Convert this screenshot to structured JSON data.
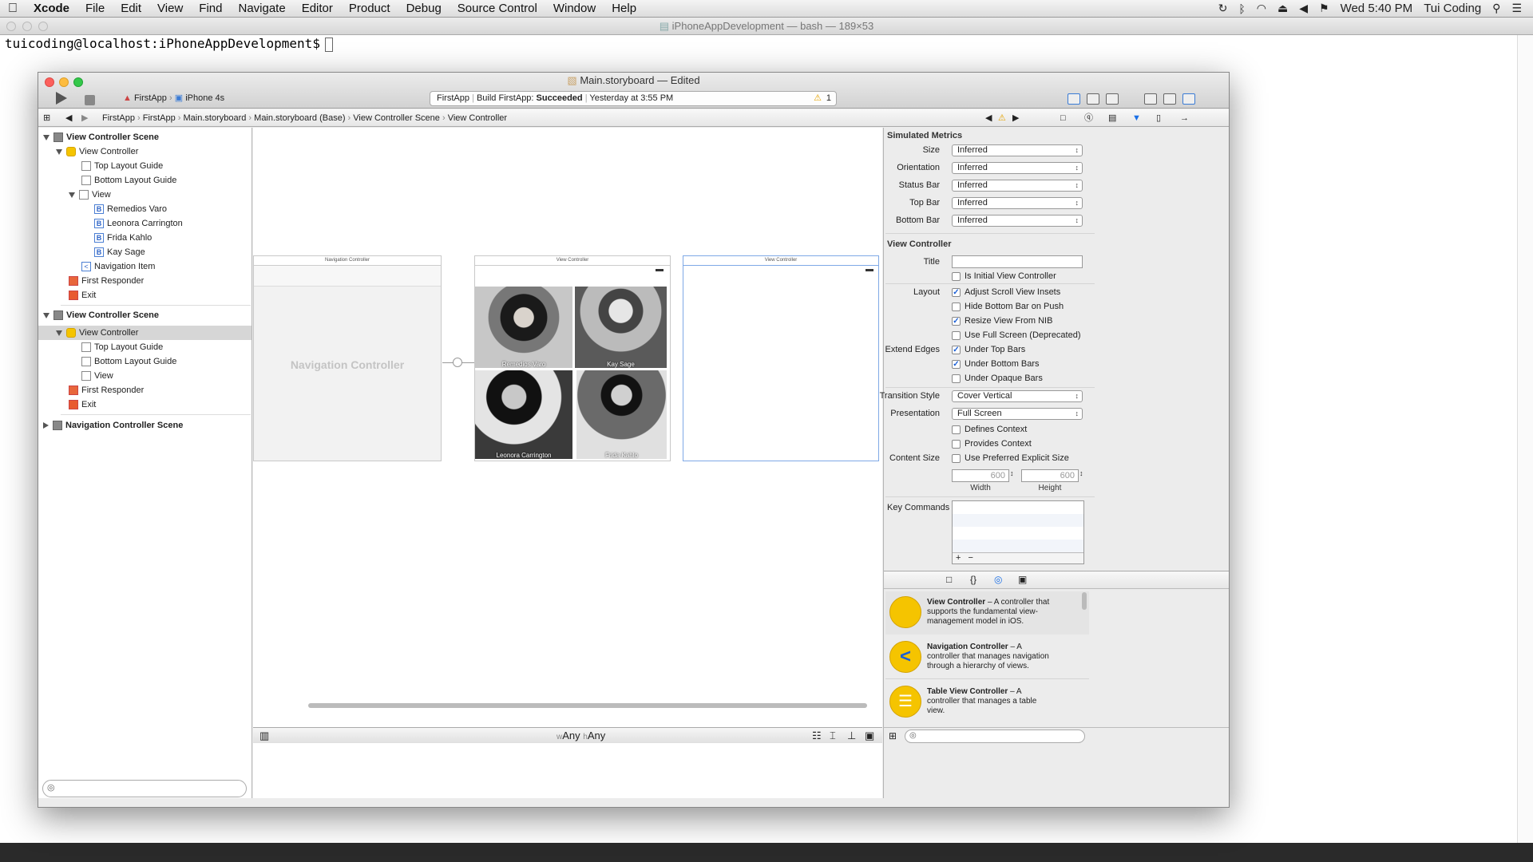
{
  "menubar": {
    "apple": "",
    "app": "Xcode",
    "items": [
      "File",
      "Edit",
      "View",
      "Find",
      "Navigate",
      "Editor",
      "Product",
      "Debug",
      "Source Control",
      "Window",
      "Help"
    ],
    "clock": "Wed 5:40 PM",
    "user": "Tui Coding"
  },
  "terminal": {
    "title": "iPhoneAppDevelopment — bash — 189×53",
    "prompt": "tuicoding@localhost:iPhoneAppDevelopment$"
  },
  "xcode": {
    "title": "Main.storyboard — Edited",
    "scheme_app": "FirstApp",
    "scheme_device": "iPhone 4s",
    "status_app": "FirstApp",
    "status_build": "Build FirstApp:",
    "status_result": "Succeeded",
    "status_time": "Yesterday at 3:55 PM",
    "warnings": "1",
    "jumpbar": [
      "FirstApp",
      "FirstApp",
      "Main.storyboard",
      "Main.storyboard (Base)",
      "View Controller Scene",
      "View Controller"
    ]
  },
  "outline": {
    "scene1": "View Controller Scene",
    "vc1": "View Controller",
    "top1": "Top Layout Guide",
    "bottom1": "Bottom Layout Guide",
    "view1": "View",
    "btn1": "Remedios Varo",
    "btn2": "Leonora Carrington",
    "btn3": "Frida Kahlo",
    "btn4": "Kay Sage",
    "navitem": "Navigation Item",
    "fr1": "First Responder",
    "exit1": "Exit",
    "scene2": "View Controller Scene",
    "vc2": "View Controller",
    "top2": "Top Layout Guide",
    "bottom2": "Bottom Layout Guide",
    "view2": "View",
    "fr2": "First Responder",
    "exit2": "Exit",
    "scene3": "Navigation Controller Scene"
  },
  "canvas": {
    "nav_title": "Navigation Controller",
    "nav_label": "Navigation Controller",
    "vc_title": "View Controller",
    "vc2_title": "View Controller",
    "photos": [
      "Remedios Varo",
      "Kay Sage",
      "Leonora Carrington",
      "Frida Kahlo"
    ],
    "size_w": "Any",
    "size_h": "Any"
  },
  "inspector": {
    "sim_metrics": "Simulated Metrics",
    "size_label": "Size",
    "size_value": "Inferred",
    "orient_label": "Orientation",
    "orient_value": "Inferred",
    "statusbar_label": "Status Bar",
    "statusbar_value": "Inferred",
    "topbar_label": "Top Bar",
    "topbar_value": "Inferred",
    "bottombar_label": "Bottom Bar",
    "bottombar_value": "Inferred",
    "vc_section": "View Controller",
    "title_label": "Title",
    "initial": "Is Initial View Controller",
    "layout_label": "Layout",
    "adjust": "Adjust Scroll View Insets",
    "hidebottom": "Hide Bottom Bar on Push",
    "resize": "Resize View From NIB",
    "fullscreen": "Use Full Screen (Deprecated)",
    "extend_label": "Extend Edges",
    "undertop": "Under Top Bars",
    "underbottom": "Under Bottom Bars",
    "underopaque": "Under Opaque Bars",
    "transition_label": "Transition Style",
    "transition_value": "Cover Vertical",
    "presentation_label": "Presentation",
    "presentation_value": "Full Screen",
    "defines": "Defines Context",
    "provides": "Provides Context",
    "contentsize_label": "Content Size",
    "preferred": "Use Preferred Explicit Size",
    "width_value": "600",
    "height_value": "600",
    "width_label": "Width",
    "height_label": "Height",
    "keycmd_label": "Key Commands",
    "add": "+",
    "remove": "−"
  },
  "library": [
    {
      "title": "View Controller",
      "desc": " – A controller that supports the fundamental view-management model in iOS."
    },
    {
      "title": "Navigation Controller",
      "desc": " – A controller that manages navigation through a hierarchy of views."
    },
    {
      "title": "Table View Controller",
      "desc": " – A controller that manages a table view."
    }
  ]
}
